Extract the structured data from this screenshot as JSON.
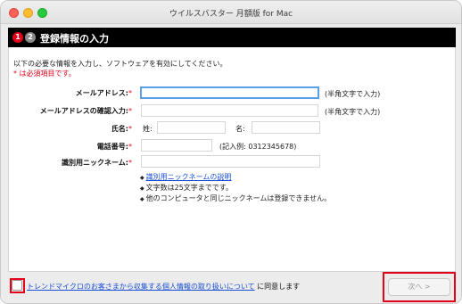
{
  "window": {
    "title": "ウイルスバスター 月額版 for Mac"
  },
  "header": {
    "step1": "1",
    "step2": "2",
    "title": "登録情報の入力"
  },
  "intro": "以下の必要な情報を入力し、ソフトウェアを有効にしてください。",
  "required_note": "* は必須項目です。",
  "form": {
    "email_label": "メールアドレス:",
    "email_hint": "(半角文字で入力)",
    "email_confirm_label": "メールアドレスの確認入力:",
    "email_confirm_hint": "(半角文字で入力)",
    "name_label": "氏名:",
    "last_name_label": "姓:",
    "first_name_label": "名:",
    "phone_label": "電話番号:",
    "phone_hint": "(記入例: 0312345678)",
    "nickname_label": "識別用ニックネーム:",
    "asterisk": "*",
    "email_value": "",
    "email_confirm_value": "",
    "last_name_value": "",
    "first_name_value": "",
    "phone_value": "",
    "nickname_value": ""
  },
  "notes": {
    "bullet": "◆",
    "nickname_link": "識別用ニックネームの説明",
    "char_limit": "文字数は25文字までです。",
    "unique": "他のコンピュータと同じニックネームは登録できません。"
  },
  "footer": {
    "consent_link": "トレンドマイクロのお客さまから収集する個人情報の取り扱いについて",
    "consent_suffix": " に同意します",
    "checkbox_checked": false,
    "next_label": "次へ >"
  },
  "colors": {
    "accent_red": "#e2001a",
    "link_blue": "#1a4fd6",
    "focus_blue": "#5b9ee9"
  }
}
